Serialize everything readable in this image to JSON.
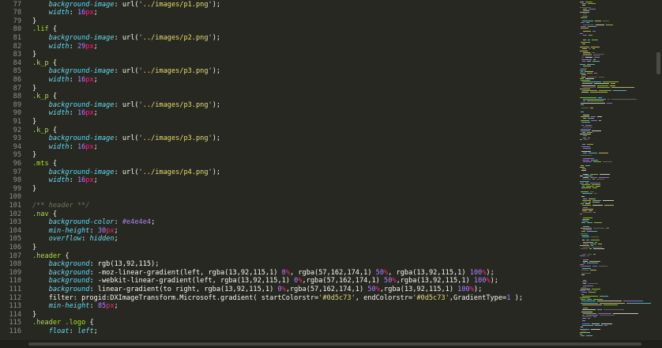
{
  "colors": {
    "background": "#272822",
    "gutter_text": "#8f908a",
    "selector": "#a6e22e",
    "property": "#66d9ef",
    "string": "#e6db74",
    "number": "#ae81ff",
    "unit": "#f92672",
    "plain": "#f8f8f2",
    "comment": "#75715e"
  },
  "editor": {
    "lines": [
      {
        "n": "77",
        "t": [
          [
            "    ",
            "w"
          ],
          [
            "background-image",
            "p"
          ],
          [
            ": url(",
            "w"
          ],
          [
            "'../images/p1.png'",
            "s"
          ],
          [
            ");",
            "w"
          ]
        ]
      },
      {
        "n": "78",
        "t": [
          [
            "    ",
            "w"
          ],
          [
            "width",
            "p"
          ],
          [
            ": ",
            "w"
          ],
          [
            "16",
            "n"
          ],
          [
            "px",
            "u"
          ],
          [
            ";",
            "w"
          ]
        ]
      },
      {
        "n": "79",
        "t": [
          [
            "}",
            "w"
          ]
        ]
      },
      {
        "n": "80",
        "t": [
          [
            ".lif",
            "g"
          ],
          [
            " {",
            "w"
          ]
        ]
      },
      {
        "n": "81",
        "t": [
          [
            "    ",
            "w"
          ],
          [
            "background-image",
            "p"
          ],
          [
            ": url(",
            "w"
          ],
          [
            "'../images/p2.png'",
            "s"
          ],
          [
            ");",
            "w"
          ]
        ]
      },
      {
        "n": "82",
        "t": [
          [
            "    ",
            "w"
          ],
          [
            "width",
            "p"
          ],
          [
            ": ",
            "w"
          ],
          [
            "29",
            "n"
          ],
          [
            "px",
            "u"
          ],
          [
            ";",
            "w"
          ]
        ]
      },
      {
        "n": "83",
        "t": [
          [
            "}",
            "w"
          ]
        ]
      },
      {
        "n": "84",
        "t": [
          [
            ".k_p",
            "g"
          ],
          [
            " {",
            "w"
          ]
        ]
      },
      {
        "n": "85",
        "t": [
          [
            "    ",
            "w"
          ],
          [
            "background-image",
            "p"
          ],
          [
            ": url(",
            "w"
          ],
          [
            "'../images/p3.png'",
            "s"
          ],
          [
            ");",
            "w"
          ]
        ]
      },
      {
        "n": "86",
        "t": [
          [
            "    ",
            "w"
          ],
          [
            "width",
            "p"
          ],
          [
            ": ",
            "w"
          ],
          [
            "16",
            "n"
          ],
          [
            "px",
            "u"
          ],
          [
            ";",
            "w"
          ]
        ]
      },
      {
        "n": "87",
        "t": [
          [
            "}",
            "w"
          ]
        ]
      },
      {
        "n": "88",
        "t": [
          [
            ".k_p",
            "g"
          ],
          [
            " {",
            "w"
          ]
        ]
      },
      {
        "n": "89",
        "t": [
          [
            "    ",
            "w"
          ],
          [
            "background-image",
            "p"
          ],
          [
            ": url(",
            "w"
          ],
          [
            "'../images/p3.png'",
            "s"
          ],
          [
            ");",
            "w"
          ]
        ]
      },
      {
        "n": "90",
        "t": [
          [
            "    ",
            "w"
          ],
          [
            "width",
            "p"
          ],
          [
            ": ",
            "w"
          ],
          [
            "16",
            "n"
          ],
          [
            "px",
            "u"
          ],
          [
            ";",
            "w"
          ]
        ]
      },
      {
        "n": "91",
        "t": [
          [
            "}",
            "w"
          ]
        ]
      },
      {
        "n": "92",
        "t": [
          [
            ".k_p",
            "g"
          ],
          [
            " {",
            "w"
          ]
        ]
      },
      {
        "n": "93",
        "t": [
          [
            "    ",
            "w"
          ],
          [
            "background-image",
            "p"
          ],
          [
            ": url(",
            "w"
          ],
          [
            "'../images/p3.png'",
            "s"
          ],
          [
            ");",
            "w"
          ]
        ]
      },
      {
        "n": "94",
        "t": [
          [
            "    ",
            "w"
          ],
          [
            "width",
            "p"
          ],
          [
            ": ",
            "w"
          ],
          [
            "16",
            "n"
          ],
          [
            "px",
            "u"
          ],
          [
            ";",
            "w"
          ]
        ]
      },
      {
        "n": "95",
        "t": [
          [
            "}",
            "w"
          ]
        ]
      },
      {
        "n": "96",
        "t": [
          [
            ".mts",
            "g"
          ],
          [
            " {",
            "w"
          ]
        ]
      },
      {
        "n": "97",
        "t": [
          [
            "    ",
            "w"
          ],
          [
            "background-image",
            "p"
          ],
          [
            ": url(",
            "w"
          ],
          [
            "'../images/p4.png'",
            "s"
          ],
          [
            ");",
            "w"
          ]
        ]
      },
      {
        "n": "98",
        "t": [
          [
            "    ",
            "w"
          ],
          [
            "width",
            "p"
          ],
          [
            ": ",
            "w"
          ],
          [
            "16",
            "n"
          ],
          [
            "px",
            "u"
          ],
          [
            ";",
            "w"
          ]
        ]
      },
      {
        "n": "99",
        "t": [
          [
            "}",
            "w"
          ]
        ]
      },
      {
        "n": "100",
        "t": []
      },
      {
        "n": "101",
        "t": [
          [
            "/** header **/",
            "c"
          ]
        ]
      },
      {
        "n": "102",
        "t": [
          [
            ".nav",
            "g"
          ],
          [
            " {",
            "w"
          ]
        ]
      },
      {
        "n": "103",
        "t": [
          [
            "    ",
            "w"
          ],
          [
            "background-color",
            "p"
          ],
          [
            ": ",
            "w"
          ],
          [
            "#e4e4e4",
            "n"
          ],
          [
            ";",
            "w"
          ]
        ]
      },
      {
        "n": "104",
        "t": [
          [
            "    ",
            "w"
          ],
          [
            "min-height",
            "p"
          ],
          [
            ": ",
            "w"
          ],
          [
            "30",
            "n"
          ],
          [
            "px",
            "u"
          ],
          [
            ";",
            "w"
          ]
        ]
      },
      {
        "n": "105",
        "t": [
          [
            "    ",
            "w"
          ],
          [
            "overflow",
            "p"
          ],
          [
            ": ",
            "w"
          ],
          [
            "hidden",
            "p"
          ],
          [
            ";",
            "w"
          ]
        ]
      },
      {
        "n": "106",
        "t": [
          [
            "}",
            "w"
          ]
        ]
      },
      {
        "n": "107",
        "t": [
          [
            ".header",
            "g"
          ],
          [
            " {",
            "w"
          ]
        ]
      },
      {
        "n": "108",
        "t": [
          [
            "    ",
            "w"
          ],
          [
            "background",
            "p"
          ],
          [
            ": rgb(13,92,115);",
            "w"
          ]
        ]
      },
      {
        "n": "109",
        "t": [
          [
            "    ",
            "w"
          ],
          [
            "background",
            "p"
          ],
          [
            ": -moz-linear-gradient(left, rgba(13,92,115,1) ",
            "w"
          ],
          [
            "0",
            "n"
          ],
          [
            "%",
            "u"
          ],
          [
            ", rgba(57,162,174,1) ",
            "w"
          ],
          [
            "50",
            "n"
          ],
          [
            "%",
            "u"
          ],
          [
            ", rgba(13,92,115,1) ",
            "w"
          ],
          [
            "100",
            "n"
          ],
          [
            "%",
            "u"
          ],
          [
            ");",
            "w"
          ]
        ]
      },
      {
        "n": "110",
        "t": [
          [
            "    ",
            "w"
          ],
          [
            "background",
            "p"
          ],
          [
            ": -webkit-linear-gradient(left, rgba(13,92,115,1) ",
            "w"
          ],
          [
            "0",
            "n"
          ],
          [
            "%",
            "u"
          ],
          [
            ",rgba(57,162,174,1) ",
            "w"
          ],
          [
            "50",
            "n"
          ],
          [
            "%",
            "u"
          ],
          [
            ",rgba(13,92,115,1) ",
            "w"
          ],
          [
            "100",
            "n"
          ],
          [
            "%",
            "u"
          ],
          [
            ");",
            "w"
          ]
        ]
      },
      {
        "n": "111",
        "t": [
          [
            "    ",
            "w"
          ],
          [
            "background",
            "p"
          ],
          [
            ": linear-gradient(to right, rgba(13,92,115,1) ",
            "w"
          ],
          [
            "0",
            "n"
          ],
          [
            "%",
            "u"
          ],
          [
            ",rgba(57,162,174,1) ",
            "w"
          ],
          [
            "50",
            "n"
          ],
          [
            "%",
            "u"
          ],
          [
            ",rgba(13,92,115,1) ",
            "w"
          ],
          [
            "100",
            "n"
          ],
          [
            "%",
            "u"
          ],
          [
            ");",
            "w"
          ]
        ]
      },
      {
        "n": "112",
        "t": [
          [
            "    filter: progid:DXImageTransform.Microsoft.gradient( startColorstr=",
            "w"
          ],
          [
            "'#0d5c73'",
            "s"
          ],
          [
            ", endColorstr=",
            "w"
          ],
          [
            "'#0d5c73'",
            "s"
          ],
          [
            ",GradientType=",
            "w"
          ],
          [
            "1",
            "n"
          ],
          [
            " );",
            "w"
          ]
        ]
      },
      {
        "n": "113",
        "t": [
          [
            "    ",
            "w"
          ],
          [
            "min-height",
            "p"
          ],
          [
            ": ",
            "w"
          ],
          [
            "85",
            "n"
          ],
          [
            "px",
            "u"
          ],
          [
            ";",
            "w"
          ]
        ]
      },
      {
        "n": "114",
        "t": [
          [
            "}",
            "w"
          ]
        ]
      },
      {
        "n": "115",
        "t": [
          [
            ".header .logo",
            "g"
          ],
          [
            " {",
            "w"
          ]
        ]
      },
      {
        "n": "116",
        "t": [
          [
            "    ",
            "w"
          ],
          [
            "float",
            "p"
          ],
          [
            ": ",
            "w"
          ],
          [
            "left",
            "p"
          ],
          [
            ";",
            "w"
          ]
        ]
      }
    ]
  }
}
